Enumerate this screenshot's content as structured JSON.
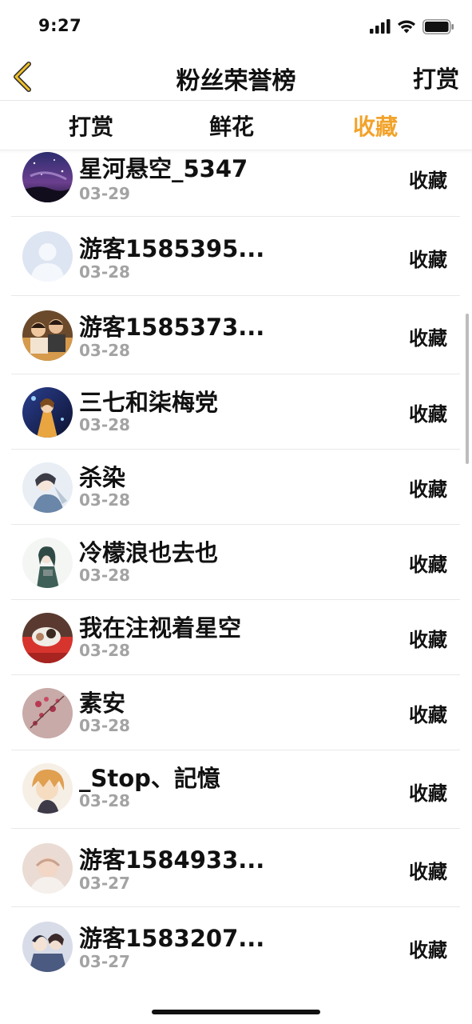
{
  "status_bar": {
    "time": "9:27"
  },
  "nav": {
    "title": "粉丝荣誉榜",
    "right_action": "打赏",
    "back_icon": "chevron-left-icon",
    "accent_color": "#f2a32b"
  },
  "tabs": [
    {
      "label": "打赏",
      "active": false
    },
    {
      "label": "鲜花",
      "active": false
    },
    {
      "label": "收藏",
      "active": true
    }
  ],
  "fans": [
    {
      "name": "星河悬空_5347",
      "date": "03-29",
      "action": "收藏"
    },
    {
      "name": "游客1585395...",
      "date": "03-28",
      "action": "收藏"
    },
    {
      "name": "游客1585373...",
      "date": "03-28",
      "action": "收藏"
    },
    {
      "name": "三七和柒梅党",
      "date": "03-28",
      "action": "收藏"
    },
    {
      "name": "杀染",
      "date": "03-28",
      "action": "收藏"
    },
    {
      "name": "冷檬浪也去也",
      "date": "03-28",
      "action": "收藏"
    },
    {
      "name": "我在注视着星空",
      "date": "03-28",
      "action": "收藏"
    },
    {
      "name": "素安",
      "date": "03-28",
      "action": "收藏"
    },
    {
      "name": "_Stop、記憶",
      "date": "03-28",
      "action": "收藏"
    },
    {
      "name": "游客1584933...",
      "date": "03-27",
      "action": "收藏"
    },
    {
      "name": "游客1583207...",
      "date": "03-27",
      "action": "收藏"
    }
  ]
}
